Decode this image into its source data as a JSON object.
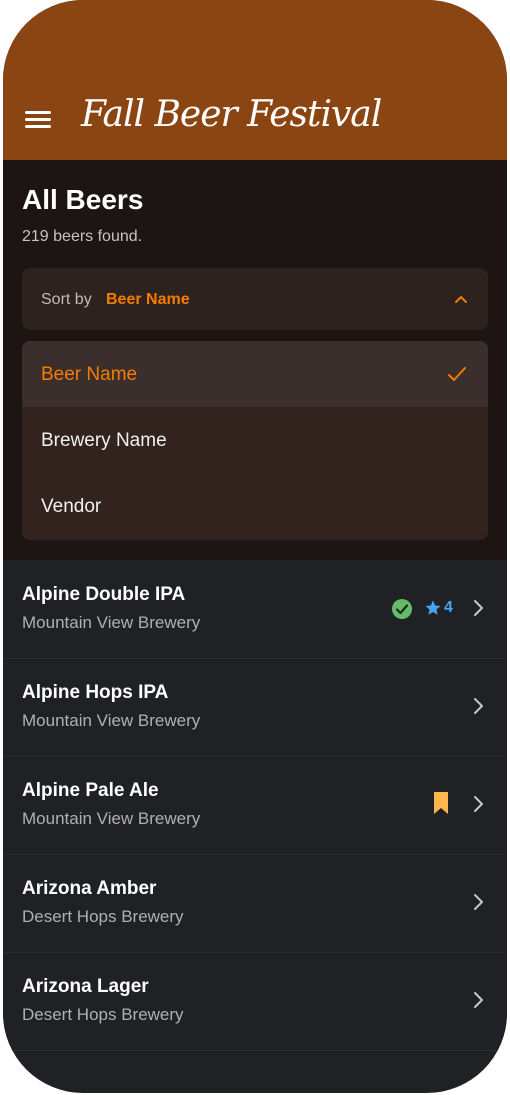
{
  "app": {
    "title": "Fall Beer Festival",
    "menu_icon": "hamburger-menu-icon"
  },
  "colors": {
    "appbar": "#8B4513",
    "accent": "#F57C00",
    "background": "#202124",
    "check_badge": "#66BB6A",
    "rating": "#42A5F5",
    "bookmark": "#FFB74D"
  },
  "page": {
    "title": "All Beers",
    "count_text": "219 beers found."
  },
  "sort": {
    "label": "Sort by",
    "selected": "Beer Name",
    "options": [
      {
        "label": "Beer Name",
        "selected": true
      },
      {
        "label": "Brewery Name",
        "selected": false
      },
      {
        "label": "Vendor",
        "selected": false
      }
    ]
  },
  "beers": [
    {
      "name": "Alpine Double IPA",
      "brewery": "Mountain View Brewery",
      "checked_in": true,
      "rating": "4",
      "bookmarked": false
    },
    {
      "name": "Alpine Hops IPA",
      "brewery": "Mountain View Brewery",
      "checked_in": false,
      "rating": "",
      "bookmarked": false
    },
    {
      "name": "Alpine Pale Ale",
      "brewery": "Mountain View Brewery",
      "checked_in": false,
      "rating": "",
      "bookmarked": true
    },
    {
      "name": "Arizona Amber",
      "brewery": "Desert Hops Brewery",
      "checked_in": false,
      "rating": "",
      "bookmarked": false
    },
    {
      "name": "Arizona Lager",
      "brewery": "Desert Hops Brewery",
      "checked_in": false,
      "rating": "",
      "bookmarked": false
    }
  ]
}
